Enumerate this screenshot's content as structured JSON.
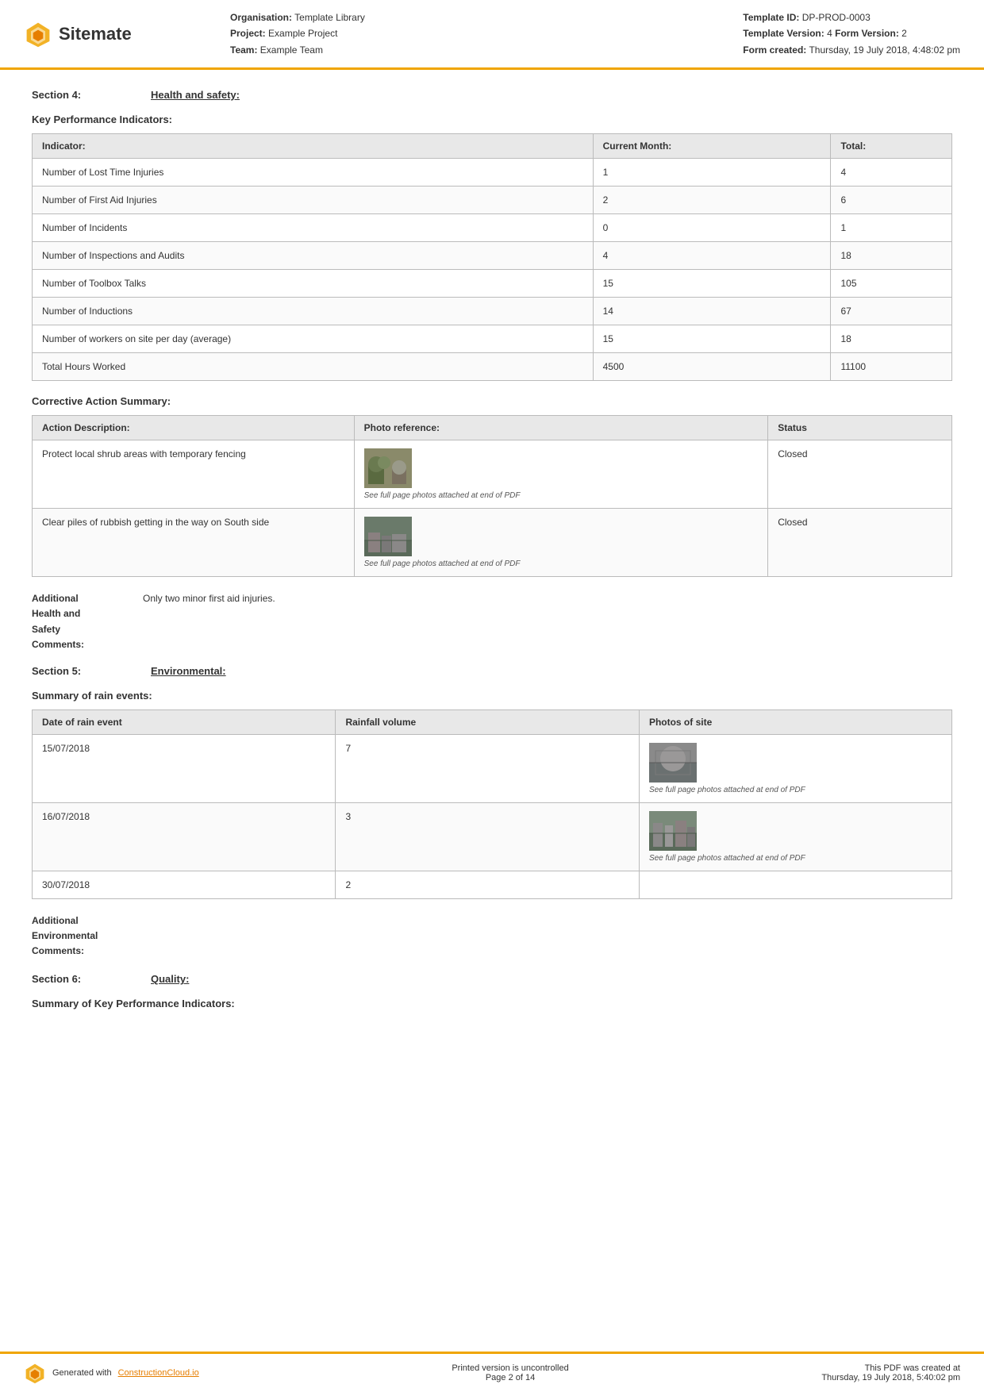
{
  "header": {
    "logo_text": "Sitemate",
    "org_label": "Organisation:",
    "org_value": "Template Library",
    "project_label": "Project:",
    "project_value": "Example Project",
    "team_label": "Team:",
    "team_value": "Example Team",
    "template_id_label": "Template ID:",
    "template_id_value": "DP-PROD-0003",
    "template_version_label": "Template Version:",
    "template_version_value": "4",
    "form_version_label": "Form Version:",
    "form_version_value": "2",
    "form_created_label": "Form created:",
    "form_created_value": "Thursday, 19 July 2018, 4:48:02 pm"
  },
  "section4": {
    "label": "Section 4:",
    "title": "Health and safety:",
    "kpi_heading": "Key Performance Indicators:",
    "kpi_table": {
      "headers": [
        "Indicator:",
        "Current Month:",
        "Total:"
      ],
      "rows": [
        [
          "Number of Lost Time Injuries",
          "1",
          "4"
        ],
        [
          "Number of First Aid Injuries",
          "2",
          "6"
        ],
        [
          "Number of Incidents",
          "0",
          "1"
        ],
        [
          "Number of Inspections and Audits",
          "4",
          "18"
        ],
        [
          "Number of Toolbox Talks",
          "15",
          "105"
        ],
        [
          "Number of Inductions",
          "14",
          "67"
        ],
        [
          "Number of workers on site per day (average)",
          "15",
          "18"
        ],
        [
          "Total Hours Worked",
          "4500",
          "11100"
        ]
      ]
    },
    "corrective_heading": "Corrective Action Summary:",
    "corrective_table": {
      "headers": [
        "Action Description:",
        "Photo reference:",
        "Status"
      ],
      "rows": [
        {
          "description": "Protect local shrub areas with temporary fencing",
          "photo_caption": "See full page photos attached at end of PDF",
          "status": "Closed"
        },
        {
          "description": "Clear piles of rubbish getting in the way on South side",
          "photo_caption": "See full page photos attached at end of PDF",
          "status": "Closed"
        }
      ]
    },
    "additional_label": "Additional\nHealth and\nSafety\nComments:",
    "additional_value": "Only two minor first aid injuries."
  },
  "section5": {
    "label": "Section 5:",
    "title": "Environmental:",
    "rain_heading": "Summary of rain events:",
    "rain_table": {
      "headers": [
        "Date of rain event",
        "Rainfall volume",
        "Photos of site"
      ],
      "rows": [
        {
          "date": "15/07/2018",
          "volume": "7",
          "photo_caption": "See full page photos attached at end of PDF",
          "has_photo": true
        },
        {
          "date": "16/07/2018",
          "volume": "3",
          "photo_caption": "See full page photos attached at end of PDF",
          "has_photo": true
        },
        {
          "date": "30/07/2018",
          "volume": "2",
          "photo_caption": "",
          "has_photo": false
        }
      ]
    },
    "additional_label": "Additional\nEnvironmental\nComments:",
    "additional_value": ""
  },
  "section6": {
    "label": "Section 6:",
    "title": "Quality:",
    "kpi_summary_heading": "Summary of Key Performance Indicators:"
  },
  "footer": {
    "generated_text": "Generated with ",
    "link_text": "ConstructionCloud.io",
    "print_note": "Printed version is uncontrolled",
    "page_info": "Page 2 of 14",
    "pdf_created_label": "This PDF was created at",
    "pdf_created_value": "Thursday, 19 July 2018, 5:40:02 pm"
  }
}
